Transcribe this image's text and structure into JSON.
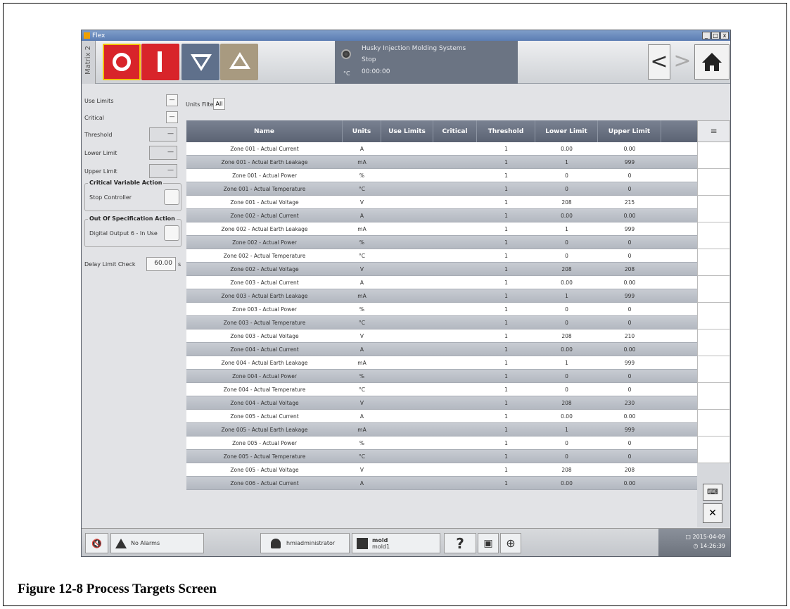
{
  "window": {
    "title": "Flex",
    "controls": [
      "_",
      "□",
      "x"
    ]
  },
  "toolbar": {
    "matrix_label": "Matrix 2",
    "status": {
      "company": "Husky Injection Molding Systems",
      "state": "Stop",
      "unit": "°C",
      "time": "00:00:00"
    },
    "nav_back": "<",
    "nav_forward": ">"
  },
  "left_panel": {
    "use_limits": "Use Limits",
    "use_limits_value": "—",
    "critical": "Critical",
    "critical_value": "—",
    "threshold": "Threshold",
    "threshold_value": "—",
    "lower_limit": "Lower Limit",
    "lower_limit_value": "—",
    "upper_limit": "Upper Limit",
    "upper_limit_value": "—",
    "critical_action_title": "Critical Variable Action",
    "critical_action_label": "Stop Controller",
    "oos_action_title": "Out Of Specification Action",
    "oos_action_label": "Digital Output 6 - In Use",
    "delay_label": "Delay Limit Check",
    "delay_value": "60.00",
    "delay_unit": "s"
  },
  "units_filter": {
    "label": "Units Filter",
    "value": "All"
  },
  "table": {
    "headers": [
      "Name",
      "Units",
      "Use Limits",
      "Critical",
      "Threshold",
      "Lower Limit",
      "Upper Limit"
    ],
    "rows": [
      [
        "Zone 001 - Actual Current",
        "A",
        "",
        "",
        "1",
        "0.00",
        "0.00"
      ],
      [
        "Zone 001 - Actual Earth Leakage",
        "mA",
        "",
        "",
        "1",
        "1",
        "999"
      ],
      [
        "Zone 001 - Actual Power",
        "%",
        "",
        "",
        "1",
        "0",
        "0"
      ],
      [
        "Zone 001 - Actual Temperature",
        "°C",
        "",
        "",
        "1",
        "0",
        "0"
      ],
      [
        "Zone 001 - Actual Voltage",
        "V",
        "",
        "",
        "1",
        "208",
        "215"
      ],
      [
        "Zone 002 - Actual Current",
        "A",
        "",
        "",
        "1",
        "0.00",
        "0.00"
      ],
      [
        "Zone 002 - Actual Earth Leakage",
        "mA",
        "",
        "",
        "1",
        "1",
        "999"
      ],
      [
        "Zone 002 - Actual Power",
        "%",
        "",
        "",
        "1",
        "0",
        "0"
      ],
      [
        "Zone 002 - Actual Temperature",
        "°C",
        "",
        "",
        "1",
        "0",
        "0"
      ],
      [
        "Zone 002 - Actual Voltage",
        "V",
        "",
        "",
        "1",
        "208",
        "208"
      ],
      [
        "Zone 003 - Actual Current",
        "A",
        "",
        "",
        "1",
        "0.00",
        "0.00"
      ],
      [
        "Zone 003 - Actual Earth Leakage",
        "mA",
        "",
        "",
        "1",
        "1",
        "999"
      ],
      [
        "Zone 003 - Actual Power",
        "%",
        "",
        "",
        "1",
        "0",
        "0"
      ],
      [
        "Zone 003 - Actual Temperature",
        "°C",
        "",
        "",
        "1",
        "0",
        "0"
      ],
      [
        "Zone 003 - Actual Voltage",
        "V",
        "",
        "",
        "1",
        "208",
        "210"
      ],
      [
        "Zone 004 - Actual Current",
        "A",
        "",
        "",
        "1",
        "0.00",
        "0.00"
      ],
      [
        "Zone 004 - Actual Earth Leakage",
        "mA",
        "",
        "",
        "1",
        "1",
        "999"
      ],
      [
        "Zone 004 - Actual Power",
        "%",
        "",
        "",
        "1",
        "0",
        "0"
      ],
      [
        "Zone 004 - Actual Temperature",
        "°C",
        "",
        "",
        "1",
        "0",
        "0"
      ],
      [
        "Zone 004 - Actual Voltage",
        "V",
        "",
        "",
        "1",
        "208",
        "230"
      ],
      [
        "Zone 005 - Actual Current",
        "A",
        "",
        "",
        "1",
        "0.00",
        "0.00"
      ],
      [
        "Zone 005 - Actual Earth Leakage",
        "mA",
        "",
        "",
        "1",
        "1",
        "999"
      ],
      [
        "Zone 005 - Actual Power",
        "%",
        "",
        "",
        "1",
        "0",
        "0"
      ],
      [
        "Zone 005 - Actual Temperature",
        "°C",
        "",
        "",
        "1",
        "0",
        "0"
      ],
      [
        "Zone 005 - Actual Voltage",
        "V",
        "",
        "",
        "1",
        "208",
        "208"
      ],
      [
        "Zone 006 - Actual Current",
        "A",
        "",
        "",
        "1",
        "0.00",
        "0.00"
      ]
    ]
  },
  "footer": {
    "alarm_text": "No Alarms",
    "user": "hmiadministrator",
    "mold_title": "mold",
    "mold_name": "mold1",
    "help": "?",
    "date": "2015-04-09",
    "time": "14:26:39"
  },
  "caption": "Figure 12-8 Process Targets Screen",
  "colors": {
    "stop_red": "#d8242a",
    "header_gray": "#5b6373",
    "accent_green": "#3d8b68"
  }
}
